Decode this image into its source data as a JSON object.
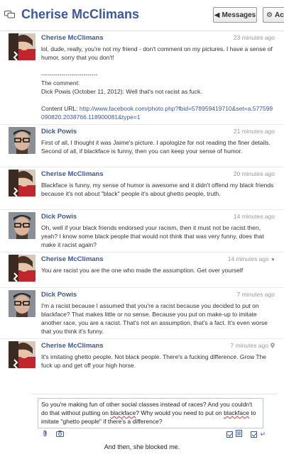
{
  "header": {
    "title": "Cherise McClimans",
    "messages_button": "Messages",
    "actions_button": "Ac"
  },
  "messages": [
    {
      "sender": "Cherise McClimans",
      "time": "23 minutes ago",
      "lines": [
        "lol, dude, really, you're not my friend - don't comment on my pictures. I have a sense of humor, sorry that you don't!",
        "----------------------------",
        "The comment:",
        "Dick Powis (October 11, 2012): Well that's not racist as fuck.",
        "Content URL: "
      ],
      "url": "http://www.facebook.com/photo.php?fbid=578959419710&set=a.577599090820.2038766.118900081&type=1"
    },
    {
      "sender": "Dick Powis",
      "time": "21 minutes ago",
      "text": "First of all, I thought it was Jaime's picture. I apologize for not reading the finer details. Second of all, if blackface is funny, then you can keep your sense of humor."
    },
    {
      "sender": "Cherise McClimans",
      "time": "20 minutes ago",
      "text": "Blackface is funny, my sense of humor is awesome and it didn't offend my black friends because it's not about \"black\" people it's about ghetto people, truth."
    },
    {
      "sender": "Dick Powis",
      "time": "14 minutes ago",
      "text": "Oh, well if your black friends endorsed your racism, then it must not be racist then, yeah? I know some black people that would not think that was very funny, does that make it racist again?"
    },
    {
      "sender": "Cherise McClimans",
      "time": "14 minutes ago",
      "text": "You are racist you are the one who made the assumption. Get over yourself"
    },
    {
      "sender": "Dick Powis",
      "time": "7 minutes ago",
      "text": "I'm a racist because I assumed that you're a racist because you decided to put on blackface? That makes little or no sense. Because you put on make-up to imitate another race, you are a racist. That's not an assumption, that's a fact. It's even worse that you think it's funny."
    },
    {
      "sender": "Cherise McClimans",
      "time": "7 minutes ago",
      "text": "It's imitating ghetto people. Not black people. There's a fucking difference. Grow The fuck up and get off your high horse."
    }
  ],
  "compose": {
    "part1": "So you're making fun of other social classes instead of races? And you couldn't do that without putting on ",
    "word1": "blackface",
    "part2": "? Why would you need to put on ",
    "word2": "blackface",
    "part3": " to imitate \"ghetto people\" if there's a difference?"
  },
  "caption": "And then, she blocked me.",
  "colors": {
    "link": "#3b5998",
    "time": "#999999",
    "border": "#bdc7d8"
  }
}
